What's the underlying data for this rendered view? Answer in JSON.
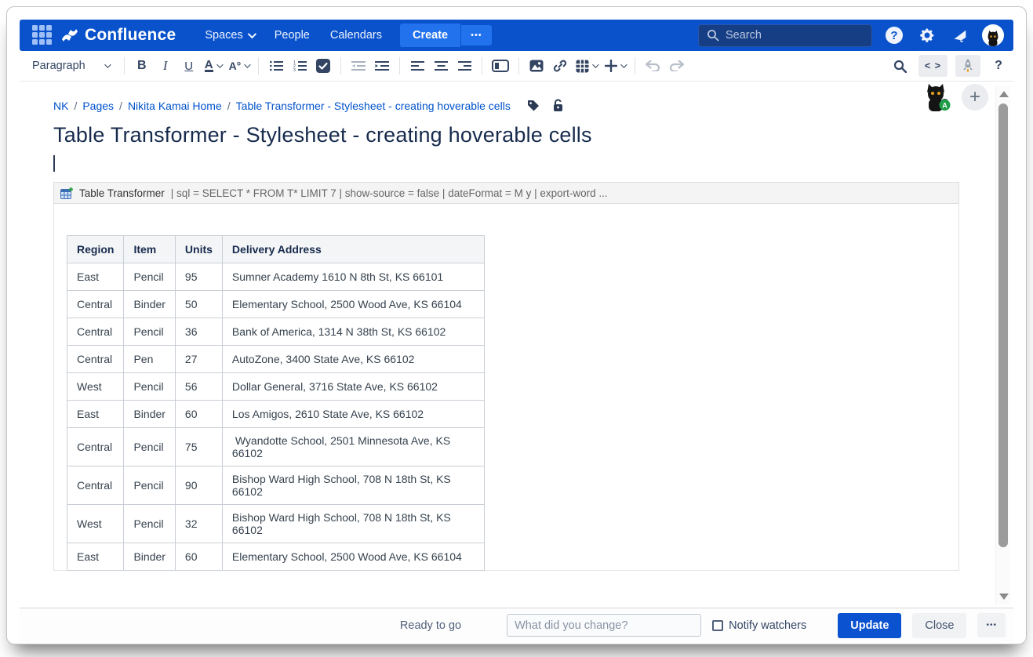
{
  "topnav": {
    "logo_text": "Confluence",
    "menu": {
      "spaces": "Spaces",
      "people": "People",
      "calendars": "Calendars"
    },
    "create_label": "Create",
    "create_more_label": "•••",
    "search_placeholder": "Search",
    "help_label": "?"
  },
  "toolbar": {
    "paragraph_label": "Paragraph",
    "bold_label": "B",
    "italic_label": "I",
    "underline_label": "U",
    "text_color_label": "A",
    "more_format_label": "A°",
    "source_label": "< >",
    "help_label": "?"
  },
  "breadcrumb": {
    "separator": "/",
    "items": [
      "NK",
      "Pages",
      "Nikita Kamai Home",
      "Table Transformer - Stylesheet - creating hoverable cells"
    ]
  },
  "page": {
    "title": "Table Transformer - Stylesheet - creating hoverable cells"
  },
  "macro": {
    "name": "Table Transformer",
    "params": "| sql = SELECT  * FROM T* LIMIT 7 | show-source = false | dateFormat = M y | export-word ..."
  },
  "table": {
    "headers": [
      "Region",
      "Item",
      "Units",
      "Delivery Address"
    ],
    "rows": [
      {
        "region": "East",
        "item": "Pencil",
        "units": "95",
        "address": "Sumner Academy 1610 N 8th St, KS 66101"
      },
      {
        "region": "Central",
        "item": "Binder",
        "units": "50",
        "address": "Elementary School, 2500 Wood Ave, KS 66104"
      },
      {
        "region": "Central",
        "item": "Pencil",
        "units": "36",
        "address": "Bank of America, 1314 N 38th St, KS 66102"
      },
      {
        "region": "Central",
        "item": "Pen",
        "units": "27",
        "address": "AutoZone, 3400 State Ave, KS 66102"
      },
      {
        "region": "West",
        "item": "Pencil",
        "units": "56",
        "address": "Dollar General, 3716 State Ave, KS 66102"
      },
      {
        "region": "East",
        "item": "Binder",
        "units": "60",
        "address": "Los Amigos, 2610 State Ave, KS 66102"
      },
      {
        "region": "Central",
        "item": "Pencil",
        "units": "75",
        "address": " Wyandotte School, 2501 Minnesota Ave, KS 66102"
      },
      {
        "region": "Central",
        "item": "Pencil",
        "units": "90",
        "address": "Bishop Ward High School, 708 N 18th St, KS 66102"
      },
      {
        "region": "West",
        "item": "Pencil",
        "units": "32",
        "address": "Bishop Ward High School, 708 N 18th St, KS 66102"
      },
      {
        "region": "East",
        "item": "Binder",
        "units": "60",
        "address": "Elementary School, 2500 Wood Ave, KS 66104"
      }
    ]
  },
  "avatar_badge": "A",
  "footer": {
    "status": "Ready to go",
    "comment_placeholder": "What did you change?",
    "notify_label": "Notify watchers",
    "update_label": "Update",
    "close_label": "Close",
    "more_label": "•••"
  },
  "colors": {
    "brand_blue": "#0952CC",
    "create_button_blue": "#2272EE",
    "update_button_blue": "#0B52D0",
    "link_blue": "#0052CC",
    "title_navy": "#172B4D"
  }
}
